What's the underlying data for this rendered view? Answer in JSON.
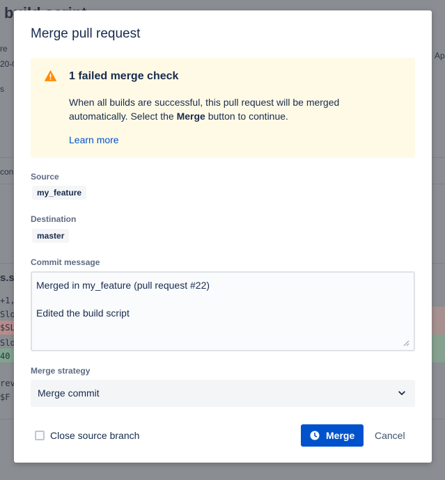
{
  "background": {
    "title": "build script",
    "fragments": [
      "re",
      "20-0",
      "s",
      "Ap",
      "con",
      "s.sh",
      "+1,",
      "Slo",
      "$SL",
      "Slo",
      "40",
      "rev",
      "$F"
    ]
  },
  "modal": {
    "title": "Merge pull request",
    "warning": {
      "icon": "warning-icon",
      "title": "1 failed merge check",
      "text_before": "When all builds are successful, this pull request will be merged automatically. Select the ",
      "text_bold": "Merge",
      "text_after": " button to continue.",
      "link": "Learn more"
    },
    "source": {
      "label": "Source",
      "branch": "my_feature"
    },
    "destination": {
      "label": "Destination",
      "branch": "master"
    },
    "commit": {
      "label": "Commit message",
      "value": "Merged in my_feature (pull request #22)\n\nEdited the build script"
    },
    "strategy": {
      "label": "Merge strategy",
      "selected": "Merge commit",
      "icon": "chevron-down-icon"
    },
    "close_branch": {
      "label": "Close source branch",
      "checked": false
    },
    "merge_button": {
      "label": "Merge",
      "icon": "clock-icon"
    },
    "cancel_button": {
      "label": "Cancel"
    }
  },
  "colors": {
    "primary": "#0052cc",
    "warning_bg": "#fffae6",
    "warning_icon": "#ff8b00",
    "text": "#172b4d",
    "muted": "#5e6c84"
  }
}
